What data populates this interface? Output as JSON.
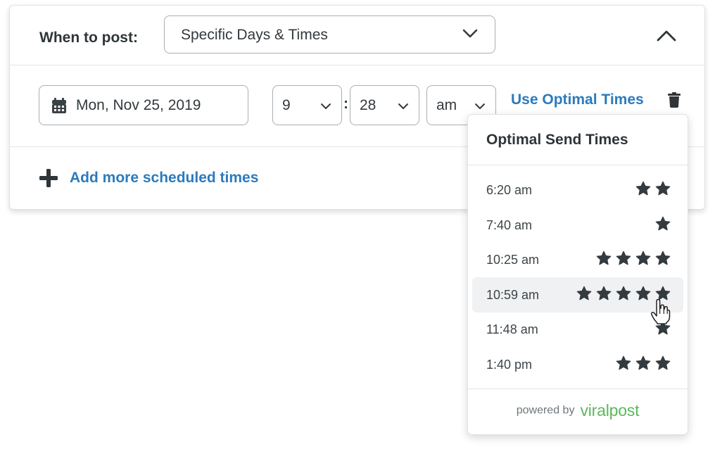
{
  "colors": {
    "link": "#2b7bbd",
    "text": "#33393d",
    "star": "#343b3e",
    "brand": "#5cb85c"
  },
  "schedule": {
    "when_label": "When to post:",
    "frequency_value": "Specific Days & Times",
    "date_value": "Mon, Nov 25, 2019",
    "hour_value": "9",
    "time_separator": ":",
    "minute_value": "28",
    "ampm_value": "am",
    "optimal_link": "Use Optimal Times",
    "add_more_label": "Add more scheduled times"
  },
  "icons": {
    "collapse": "chevron-up-icon",
    "calendar": "calendar-icon",
    "delete": "trash-icon",
    "add": "plus-icon",
    "dropdown": "chevron-down-icon",
    "rating": "star-icon",
    "pointer": "hand-pointer-icon"
  },
  "optimal_popover": {
    "title": "Optimal Send Times",
    "times": [
      {
        "time": "6:20 am",
        "stars": 2
      },
      {
        "time": "7:40 am",
        "stars": 1
      },
      {
        "time": "10:25 am",
        "stars": 4
      },
      {
        "time": "10:59 am",
        "stars": 5,
        "hovered": true
      },
      {
        "time": "11:48 am",
        "stars": 1
      },
      {
        "time": "1:40 pm",
        "stars": 3
      }
    ],
    "powered_by": "powered by",
    "brand": "viralpost"
  }
}
